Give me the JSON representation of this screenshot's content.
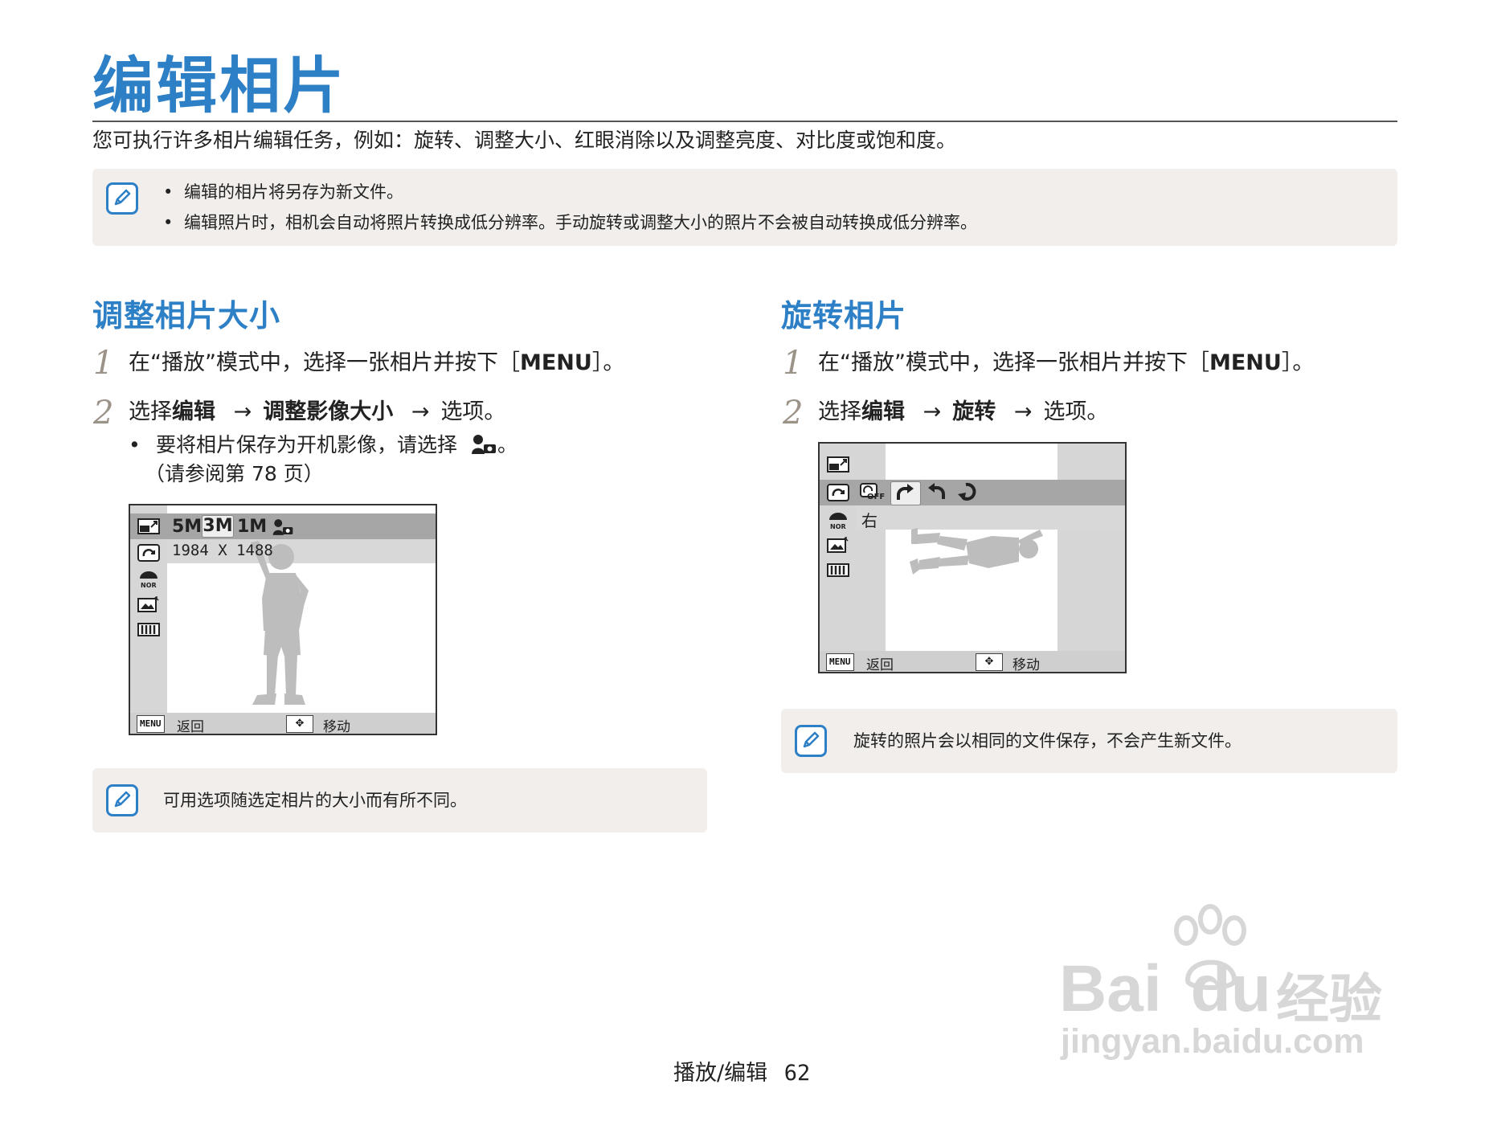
{
  "header": {
    "title": "编辑相片",
    "intro": "您可执行许多相片编辑任务，例如：旋转、调整大小、红眼消除以及调整亮度、对比度或饱和度。"
  },
  "top_note": {
    "icon": "note-pencil-icon",
    "items": [
      "编辑的相片将另存为新文件。",
      "编辑照片时，相机会自动将照片转换成低分辨率。手动旋转或调整大小的照片不会被自动转换成低分辨率。"
    ]
  },
  "resize": {
    "heading": "调整相片大小",
    "step1": {
      "num": "1",
      "pre": "在“播放”模式中，选择一张相片并按下［",
      "key": "MENU",
      "post": "］。"
    },
    "step2": {
      "num": "2",
      "pre": "选择",
      "b1": "编辑",
      "arrow1": "→",
      "b2": "调整影像大小",
      "arrow2": "→",
      "post": "选项。"
    },
    "sub1": "要将相片保存为开机影像，请选择",
    "sub1_end": "。",
    "sub2": "（请参阅第 78 页）",
    "screen": {
      "options": [
        "5M",
        "3M",
        "1M"
      ],
      "selected": "3M",
      "resolution": "1984 X 1488",
      "menu_key": "MENU",
      "back_label": "返回",
      "move_symbol": "✥",
      "move_label": "移动"
    },
    "note": "可用选项随选定相片的大小而有所不同。"
  },
  "rotate": {
    "heading": "旋转相片",
    "step1": {
      "num": "1",
      "pre": "在“播放”模式中，选择一张相片并按下［",
      "key": "MENU",
      "post": "］。"
    },
    "step2": {
      "num": "2",
      "pre": "选择",
      "b1": "编辑",
      "arrow1": "→",
      "b2": "旋转",
      "arrow2": "→",
      "post": "选项。"
    },
    "screen": {
      "off_label": "OFF",
      "direction": "右",
      "menu_key": "MENU",
      "back_label": "返回",
      "move_symbol": "✥",
      "move_label": "移动"
    },
    "note": "旋转的照片会以相同的文件保存，不会产生新文件。"
  },
  "footer": {
    "label": "播放/编辑",
    "page": "62"
  },
  "watermark": {
    "brand": "Bai",
    "brand2": "du",
    "cn": "经验",
    "url": "jingyan.baidu.com"
  },
  "colors": {
    "accent": "#2d7fc6",
    "note_bg": "#f1eeeb",
    "step_number": "#9b9288"
  }
}
